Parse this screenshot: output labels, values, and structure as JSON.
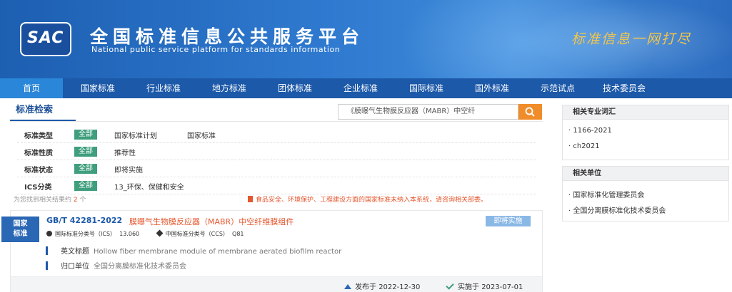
{
  "banner": {
    "logo_text": "SAC",
    "title_cn": "全国标准信息公共服务平台",
    "title_en": "National public service platform  for standards information",
    "slogan": "标准信息一网打尽"
  },
  "nav": {
    "items": [
      "首页",
      "国家标准",
      "行业标准",
      "地方标准",
      "团体标准",
      "企业标准",
      "国际标准",
      "国外标准",
      "示范试点",
      "技术委员会"
    ]
  },
  "search": {
    "section_title": "标准检索",
    "query": "《膜曝气生物膜反应器（MABR）中空纤"
  },
  "filters": {
    "all_label": "全部",
    "rows": [
      {
        "label": "标准类型",
        "values": [
          "国家标准计划",
          "国家标准"
        ]
      },
      {
        "label": "标准性质",
        "values": [
          "推荐性"
        ]
      },
      {
        "label": "标准状态",
        "values": [
          "即将实施"
        ]
      },
      {
        "label": "ICS分类",
        "values": [
          "13_环保、保健和安全"
        ]
      }
    ]
  },
  "results": {
    "note_prefix": "为您找到相关结果约",
    "count": "2",
    "note_suffix": "个",
    "notice": "食品安全、环境保护、工程建设方面的国家标准未纳入本系统，请咨询相关部委。"
  },
  "card": {
    "badge_line1": "国家",
    "badge_line2": "标准",
    "code": "GB/T 42281-2022",
    "name": "膜曝气生物膜反应器（MABR）中空纤维膜组件",
    "status": "即将实施",
    "ics_label": "国际标准分类号（ICS）",
    "ics_value": "13.060",
    "ccs_label": "中国标准分类号（CCS）",
    "ccs_value": "Q81",
    "en_title_label": "英文标题",
    "en_title_value": "Hollow fiber membrane module of membrane aerated biofilm reactor",
    "dept_label": "归口单位",
    "dept_value": "全国分离膜标准化技术委员会",
    "publish_label": "发布于",
    "publish_date": "2022-12-30",
    "effective_label": "实施于",
    "effective_date": "2023-07-01"
  },
  "sidebar": {
    "vocab_title": "相关专业词汇",
    "vocab_items": [
      "1166-2021",
      "ch2021"
    ],
    "units_title": "相关单位",
    "units_items": [
      "国家标准化管理委员会",
      "全国分离膜标准化技术委员会"
    ]
  },
  "colors": {
    "nav_bg": "#1c59a9",
    "nav_active": "#2a86d8",
    "accent_orange": "#f08c2a",
    "tag_green": "#3f9e7c",
    "highlight_red": "#e4572e"
  }
}
